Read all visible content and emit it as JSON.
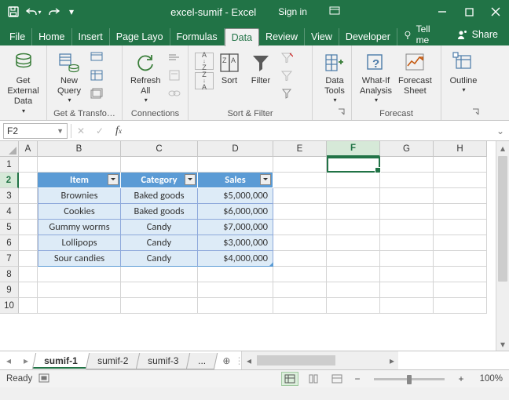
{
  "title": "excel-sumif - Excel",
  "sign_in": "Sign in",
  "tabs": {
    "file": "File",
    "home": "Home",
    "insert": "Insert",
    "page": "Page Layo",
    "formulas": "Formulas",
    "data": "Data",
    "review": "Review",
    "view": "View",
    "developer": "Developer",
    "tellme": "Tell me",
    "share": "Share"
  },
  "ribbon": {
    "get_external": "Get External\nData",
    "new_query": "New\nQuery",
    "group_transform": "Get & Transfo…",
    "refresh": "Refresh\nAll",
    "group_conn": "Connections",
    "sort": "Sort",
    "filter": "Filter",
    "group_sort": "Sort & Filter",
    "data_tools": "Data\nTools",
    "whatif": "What-If\nAnalysis",
    "forecast": "Forecast\nSheet",
    "group_forecast": "Forecast",
    "outline": "Outline"
  },
  "namebox": "F2",
  "columns": [
    "A",
    "B",
    "C",
    "D",
    "E",
    "F",
    "G",
    "H"
  ],
  "rowcount": 10,
  "active": {
    "col": "F",
    "row": 2
  },
  "table": {
    "headers": {
      "item": "Item",
      "category": "Category",
      "sales": "Sales"
    },
    "rows": [
      {
        "item": "Brownies",
        "category": "Baked goods",
        "sales": "$5,000,000"
      },
      {
        "item": "Cookies",
        "category": "Baked goods",
        "sales": "$6,000,000"
      },
      {
        "item": "Gummy worms",
        "category": "Candy",
        "sales": "$7,000,000"
      },
      {
        "item": "Lollipops",
        "category": "Candy",
        "sales": "$3,000,000"
      },
      {
        "item": "Sour candies",
        "category": "Candy",
        "sales": "$4,000,000"
      }
    ]
  },
  "sheets": [
    "sumif-1",
    "sumif-2",
    "sumif-3"
  ],
  "dots": "...",
  "status": {
    "ready": "Ready",
    "zoom": "100%"
  }
}
